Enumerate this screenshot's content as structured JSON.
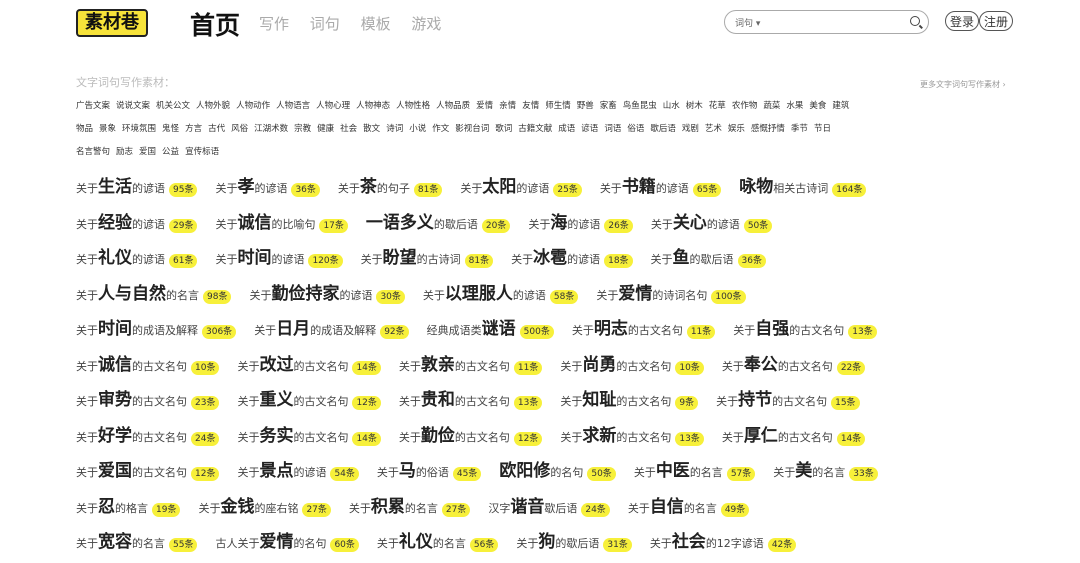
{
  "header": {
    "logo": "素材巷",
    "nav_home": "首页",
    "nav_links": [
      "写作",
      "词句",
      "模板",
      "游戏"
    ],
    "search_select": "词句 ▾",
    "search_placeholder": "",
    "login": "登录",
    "register": "注册"
  },
  "categories": {
    "title": "文字词句写作素材：",
    "more": "更多文字词句写作素材 ›",
    "rows": [
      [
        "广告文案",
        "说说文案",
        "机关公文",
        "人物外貌",
        "人物动作",
        "人物语言",
        "人物心理",
        "人物神态",
        "人物性格",
        "人物品质",
        "爱情",
        "亲情",
        "友情",
        "师生情",
        "野兽",
        "家畜",
        "鸟鱼昆虫",
        "山水",
        "树木",
        "花草",
        "农作物",
        "蔬菜",
        "水果",
        "美食",
        "建筑"
      ],
      [
        "物品",
        "景象",
        "环境氛围",
        "鬼怪",
        "方言",
        "古代",
        "风俗",
        "江湖术数",
        "宗教",
        "健康",
        "社会",
        "散文",
        "诗词",
        "小说",
        "作文",
        "影视台词",
        "歌词",
        "古籍文献",
        "成语",
        "谚语",
        "词语",
        "俗语",
        "歇后语",
        "戏剧",
        "艺术",
        "娱乐",
        "感慨抒情",
        "季节",
        "节日"
      ],
      [
        "名言警句",
        "励志",
        "爱国",
        "公益",
        "宣传标语"
      ]
    ]
  },
  "entries": [
    [
      {
        "pre": "关于",
        "key": "生活",
        "suf": "的谚语",
        "count": "95条"
      },
      {
        "pre": "关于",
        "key": "孝",
        "suf": "的谚语",
        "count": "36条"
      },
      {
        "pre": "关于",
        "key": "茶",
        "suf": "的句子",
        "count": "81条"
      },
      {
        "pre": "关于",
        "key": "太阳",
        "suf": "的谚语",
        "count": "25条"
      },
      {
        "pre": "关于",
        "key": "书籍",
        "suf": "的谚语",
        "count": "65条"
      },
      {
        "pre": "",
        "key": "咏物",
        "suf": "相关古诗词",
        "count": "164条"
      }
    ],
    [
      {
        "pre": "关于",
        "key": "经验",
        "suf": "的谚语",
        "count": "29条"
      },
      {
        "pre": "关于",
        "key": "诚信",
        "suf": "的比喻句",
        "count": "17条"
      },
      {
        "pre": "",
        "key": "一语多义",
        "suf": "的歇后语",
        "count": "20条"
      },
      {
        "pre": "关于",
        "key": "海",
        "suf": "的谚语",
        "count": "26条"
      },
      {
        "pre": "关于",
        "key": "关心",
        "suf": "的谚语",
        "count": "50条"
      }
    ],
    [
      {
        "pre": "关于",
        "key": "礼仪",
        "suf": "的谚语",
        "count": "61条"
      },
      {
        "pre": "关于",
        "key": "时间",
        "suf": "的谚语",
        "count": "120条"
      },
      {
        "pre": "关于",
        "key": "盼望",
        "suf": "的古诗词",
        "count": "81条"
      },
      {
        "pre": "关于",
        "key": "冰雹",
        "suf": "的谚语",
        "count": "18条"
      },
      {
        "pre": "关于",
        "key": "鱼",
        "suf": "的歇后语",
        "count": "36条"
      }
    ],
    [
      {
        "pre": "关于",
        "key": "人与自然",
        "suf": "的名言",
        "count": "98条"
      },
      {
        "pre": "关于",
        "key": "勤俭持家",
        "suf": "的谚语",
        "count": "30条"
      },
      {
        "pre": "关于",
        "key": "以理服人",
        "suf": "的谚语",
        "count": "58条"
      },
      {
        "pre": "关于",
        "key": "爱情",
        "suf": "的诗词名句",
        "count": "100条"
      }
    ],
    [
      {
        "pre": "关于",
        "key": "时间",
        "suf": "的成语及解释",
        "count": "306条"
      },
      {
        "pre": "关于",
        "key": "日月",
        "suf": "的成语及解释",
        "count": "92条"
      },
      {
        "pre": "经典成语类",
        "key": "谜语",
        "suf": "",
        "count": "500条"
      },
      {
        "pre": "关于",
        "key": "明志",
        "suf": "的古文名句",
        "count": "11条"
      },
      {
        "pre": "关于",
        "key": "自强",
        "suf": "的古文名句",
        "count": "13条"
      }
    ],
    [
      {
        "pre": "关于",
        "key": "诚信",
        "suf": "的古文名句",
        "count": "10条"
      },
      {
        "pre": "关于",
        "key": "改过",
        "suf": "的古文名句",
        "count": "14条"
      },
      {
        "pre": "关于",
        "key": "敦亲",
        "suf": "的古文名句",
        "count": "11条"
      },
      {
        "pre": "关于",
        "key": "尚勇",
        "suf": "的古文名句",
        "count": "10条"
      },
      {
        "pre": "关于",
        "key": "奉公",
        "suf": "的古文名句",
        "count": "22条"
      }
    ],
    [
      {
        "pre": "关于",
        "key": "审势",
        "suf": "的古文名句",
        "count": "23条"
      },
      {
        "pre": "关于",
        "key": "重义",
        "suf": "的古文名句",
        "count": "12条"
      },
      {
        "pre": "关于",
        "key": "贵和",
        "suf": "的古文名句",
        "count": "13条"
      },
      {
        "pre": "关于",
        "key": "知耻",
        "suf": "的古文名句",
        "count": "9条"
      },
      {
        "pre": "关于",
        "key": "持节",
        "suf": "的古文名句",
        "count": "15条"
      }
    ],
    [
      {
        "pre": "关于",
        "key": "好学",
        "suf": "的古文名句",
        "count": "24条"
      },
      {
        "pre": "关于",
        "key": "务实",
        "suf": "的古文名句",
        "count": "14条"
      },
      {
        "pre": "关于",
        "key": "勤俭",
        "suf": "的古文名句",
        "count": "12条"
      },
      {
        "pre": "关于",
        "key": "求新",
        "suf": "的古文名句",
        "count": "13条"
      },
      {
        "pre": "关于",
        "key": "厚仁",
        "suf": "的古文名句",
        "count": "14条"
      }
    ],
    [
      {
        "pre": "关于",
        "key": "爱国",
        "suf": "的古文名句",
        "count": "12条"
      },
      {
        "pre": "关于",
        "key": "景点",
        "suf": "的谚语",
        "count": "54条"
      },
      {
        "pre": "关于",
        "key": "马",
        "suf": "的俗语",
        "count": "45条"
      },
      {
        "pre": "",
        "key": "欧阳修",
        "suf": "的名句",
        "count": "50条"
      },
      {
        "pre": "关于",
        "key": "中医",
        "suf": "的名言",
        "count": "57条"
      },
      {
        "pre": "关于",
        "key": "美",
        "suf": "的名言",
        "count": "33条"
      }
    ],
    [
      {
        "pre": "关于",
        "key": "忍",
        "suf": "的格言",
        "count": "19条"
      },
      {
        "pre": "关于",
        "key": "金钱",
        "suf": "的座右铭",
        "count": "27条"
      },
      {
        "pre": "关于",
        "key": "积累",
        "suf": "的名言",
        "count": "27条"
      },
      {
        "pre": "汉字",
        "key": "谐音",
        "suf": "歇后语",
        "count": "24条"
      },
      {
        "pre": "关于",
        "key": "自信",
        "suf": "的名言",
        "count": "49条"
      }
    ],
    [
      {
        "pre": "关于",
        "key": "宽容",
        "suf": "的名言",
        "count": "55条"
      },
      {
        "pre": "古人关于",
        "key": "爱情",
        "suf": "的名句",
        "count": "60条"
      },
      {
        "pre": "关于",
        "key": "礼仪",
        "suf": "的名言",
        "count": "56条"
      },
      {
        "pre": "关于",
        "key": "狗",
        "suf": "的歇后语",
        "count": "31条"
      },
      {
        "pre": "关于",
        "key": "社会",
        "suf": "的12字谚语",
        "count": "42条"
      }
    ]
  ]
}
